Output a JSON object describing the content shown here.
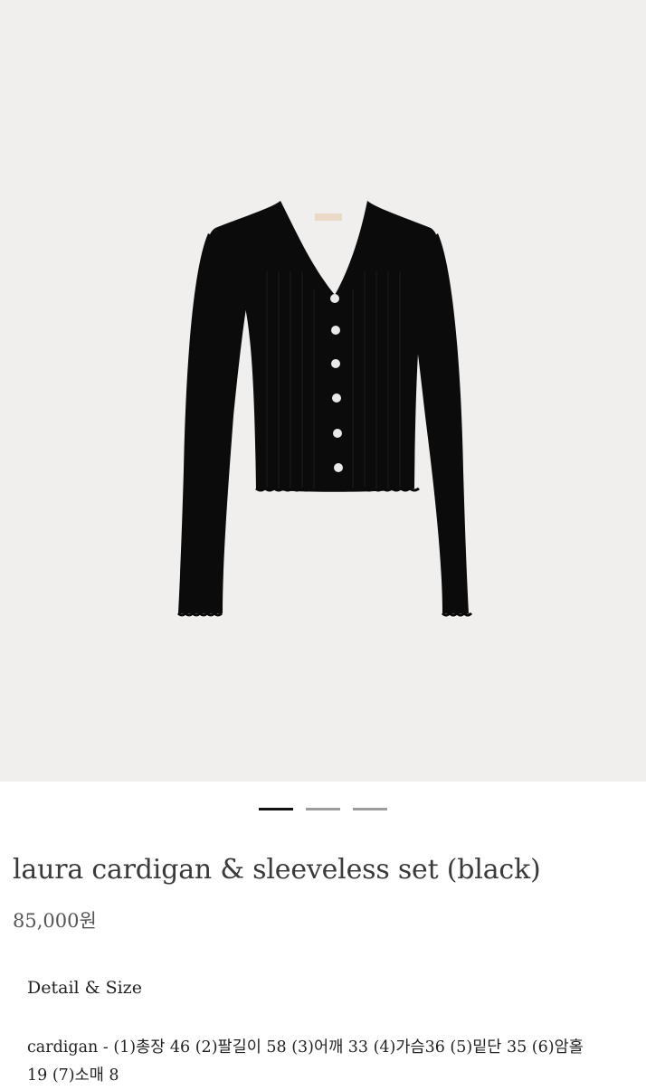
{
  "product": {
    "image_alt": "black ribbed cardigan",
    "label_tag": "",
    "title": "laura cardigan & sleeveless set (black)",
    "price": "85,000원"
  },
  "carousel": {
    "active_index": 0,
    "count": 3
  },
  "details": {
    "heading": "Detail & Size",
    "size_line_1": "cardigan - (1)총장 46 (2)팔길이 58 (3)어깨 33 (4)가슴36 (5)밑단 35 (6)암홀",
    "size_line_2": "19 (7)소매 8"
  },
  "colors": {
    "background": "#f1efed",
    "garment": "#0b0b0b",
    "button": "#e9e9e9"
  }
}
